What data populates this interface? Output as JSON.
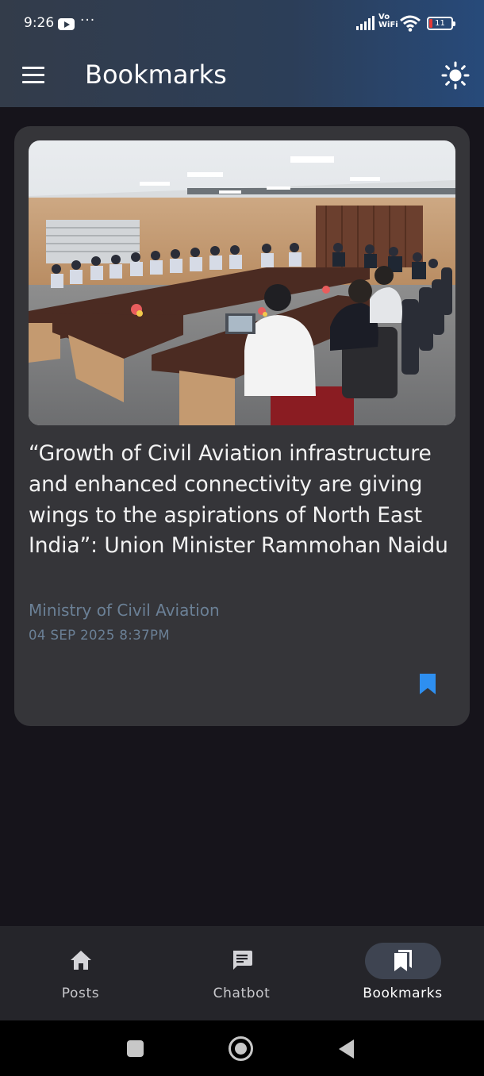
{
  "status_bar": {
    "time": "9:26",
    "overflow": "···",
    "network": "Vo\nWiFi",
    "battery": "11"
  },
  "app_bar": {
    "title": "Bookmarks",
    "menu_icon": "hamburger-menu-icon",
    "theme_icon": "sun-icon"
  },
  "article": {
    "headline": "“Growth of Civil Aviation infrastructure and enhanced connectivity are giving wings to the aspirations of North East India”: Union Minister Rammohan Naidu",
    "source": "Ministry of Civil Aviation",
    "date": "04 SEP 2025 8:37PM",
    "bookmarked": true,
    "bookmark_color": "#2e8ff0"
  },
  "bottom_nav": {
    "items": [
      {
        "label": "Posts",
        "icon": "home-icon",
        "active": false
      },
      {
        "label": "Chatbot",
        "icon": "chat-icon",
        "active": false
      },
      {
        "label": "Bookmarks",
        "icon": "bookmarks-icon",
        "active": true
      }
    ]
  },
  "colors": {
    "background": "#16141b",
    "card": "#353539",
    "accent": "#2e8ff0",
    "meta_text": "#6b8096"
  }
}
